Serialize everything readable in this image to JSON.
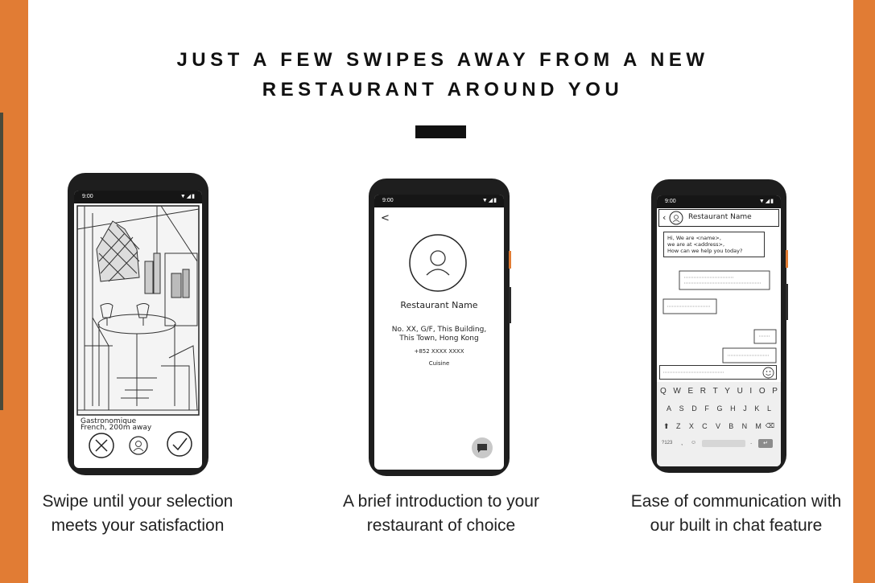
{
  "headline": {
    "line1": "JUST A FEW SWIPES AWAY FROM A NEW",
    "line2": "RESTAURANT AROUND YOU"
  },
  "phone1": {
    "status_time": "9:00",
    "restaurant_line1": "Gastronomique",
    "restaurant_line2": "French, 200m away",
    "caption_line1": "Swipe until your selection",
    "caption_line2": "meets your satisfaction"
  },
  "phone2": {
    "status_time": "9:00",
    "back_glyph": "<",
    "name": "Restaurant Name",
    "address_line1": "No. XX, G/F, This Building,",
    "address_line2": "This Town, Hong Kong",
    "phone": "+852 XXXX XXXX",
    "cuisine": "Cuisine",
    "caption_line1": "A brief introduction to your",
    "caption_line2": "restaurant of choice"
  },
  "phone3": {
    "status_time": "9:00",
    "header_name": "Restaurant Name",
    "greeting_line1": "Hi, We are <name>,",
    "greeting_line2": "we are at <address>,",
    "greeting_line3": "How can we help you today?",
    "keyboard_row1": [
      "Q",
      "W",
      "E",
      "R",
      "T",
      "Y",
      "U",
      "I",
      "O",
      "P"
    ],
    "keyboard_row2": [
      "A",
      "S",
      "D",
      "F",
      "G",
      "H",
      "J",
      "K",
      "L"
    ],
    "keyboard_row3": [
      "Z",
      "X",
      "C",
      "V",
      "B",
      "N",
      "M"
    ],
    "key_numbers": "?123",
    "caption_line1": "Ease of communication with",
    "caption_line2": "our built in chat feature"
  },
  "colors": {
    "accent": "#e17c34",
    "phone_body": "#1e1e1e"
  }
}
